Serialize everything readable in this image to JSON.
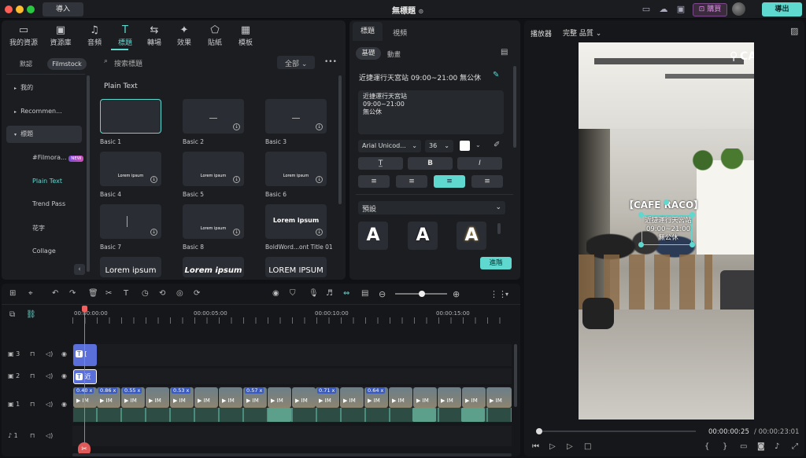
{
  "titlebar": {
    "import_label": "導入",
    "window_title": "無標題",
    "buy_label": "購買",
    "export_label": "導出",
    "traffic": [
      "#ff5f57",
      "#febc2e",
      "#28c840"
    ]
  },
  "toolbar": {
    "items": [
      {
        "label": "我的資源",
        "icon": "media-icon"
      },
      {
        "label": "資源庫",
        "icon": "library-icon"
      },
      {
        "label": "音頻",
        "icon": "music-icon"
      },
      {
        "label": "標題",
        "icon": "title-icon",
        "active": true
      },
      {
        "label": "轉場",
        "icon": "transition-icon"
      },
      {
        "label": "效果",
        "icon": "effects-icon"
      },
      {
        "label": "貼紙",
        "icon": "sticker-icon"
      },
      {
        "label": "模板",
        "icon": "template-icon"
      }
    ]
  },
  "library": {
    "seg_default": "默認",
    "seg_filmstock": "Filmstock",
    "search_placeholder": "搜索標題",
    "filter_all": "全部",
    "more": "•••",
    "section_title": "Plain Text",
    "sidebar": [
      {
        "label": "我的",
        "arrow": "▸"
      },
      {
        "label": "Recommen...",
        "arrow": "▸"
      },
      {
        "label": "標題",
        "arrow": "▾"
      }
    ],
    "subitems": [
      {
        "label": "#Filmora...",
        "badge": "NEW"
      },
      {
        "label": "Plain Text",
        "active": true
      },
      {
        "label": "Trend Pass"
      },
      {
        "label": "花字"
      },
      {
        "label": "Collage"
      }
    ],
    "thumbs": [
      {
        "label": "Basic 1",
        "preview": ""
      },
      {
        "label": "Basic 2",
        "preview": ""
      },
      {
        "label": "Basic 3",
        "preview": ""
      },
      {
        "label": "Basic 4",
        "preview": "Lorem ipsum"
      },
      {
        "label": "Basic 5",
        "preview": "Lorem ipsum"
      },
      {
        "label": "Basic 6",
        "preview": "Lorem ipsum"
      },
      {
        "label": "Basic 7",
        "preview": ""
      },
      {
        "label": "Basic 8",
        "preview": "Lorem ipsum"
      },
      {
        "label": "BoldWord...ont Title 01",
        "preview": "Lorem ipsum"
      },
      {
        "label": "",
        "preview": "Lorem ipsum"
      },
      {
        "label": "",
        "preview": "Lorem ipsum"
      },
      {
        "label": "",
        "preview": "LOREM IPSUM"
      }
    ]
  },
  "props": {
    "tab_title": "標題",
    "tab_video": "視頻",
    "sub_basic": "基礎",
    "sub_anim": "動畫",
    "title_name": "近捷運行天宮站 09:00~21:00 無公休",
    "text_lines": [
      "近捷運行天宮站",
      "09:00~21:00",
      "無公休"
    ],
    "font": "Arial Unicod...",
    "size": "36",
    "preset_label": "預設",
    "advanced": "進階",
    "bold": "B",
    "italic": "I"
  },
  "player": {
    "label": "播放器",
    "quality": "完整 品質",
    "overlay_title": "【CAFE RACO】",
    "overlay_lines": [
      "近捷運行天宮站",
      "09:00~21:00",
      "無公休"
    ],
    "corner_text": "CA",
    "current_time": "00:00:00:25",
    "total_time": "/ 00:00:23:01",
    "progress": 0.0
  },
  "timeline": {
    "ruler": [
      "00:00:00:00",
      "00:00:05:00",
      "00:00:10:00",
      "00:00:15:00"
    ],
    "tracks": [
      {
        "label": "3"
      },
      {
        "label": "2"
      },
      {
        "label": "1"
      },
      {
        "label": "1"
      }
    ],
    "speeds": [
      "0.40 x",
      "0.86 x",
      "0.55 x",
      "0.53 x",
      "0.57 x",
      "0.71 x",
      "0.64 x"
    ],
    "clip_text": "IM"
  }
}
